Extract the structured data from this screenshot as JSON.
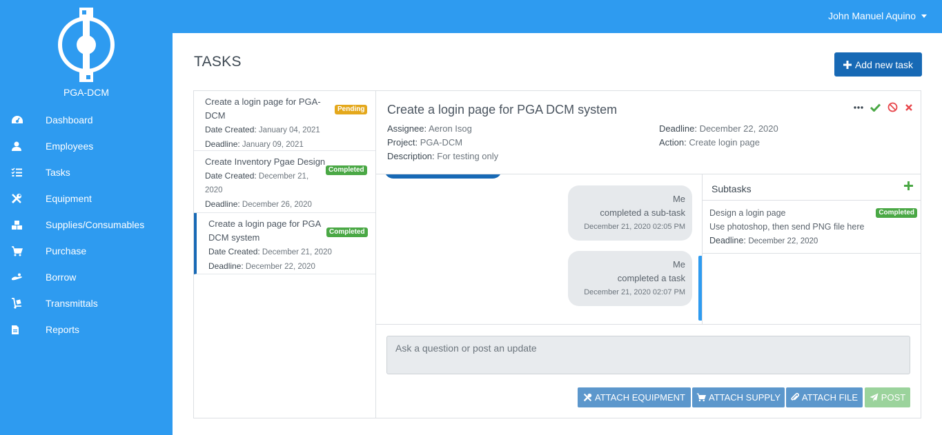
{
  "brand": {
    "name": "PGA-DCM"
  },
  "user": {
    "name": "John Manuel Aquino"
  },
  "nav": [
    {
      "id": "dashboard",
      "label": "Dashboard",
      "icon": "tachometer-icon"
    },
    {
      "id": "employees",
      "label": "Employees",
      "icon": "user-icon"
    },
    {
      "id": "tasks",
      "label": "Tasks",
      "icon": "tasks-list-icon"
    },
    {
      "id": "equipment",
      "label": "Equipment",
      "icon": "tools-icon"
    },
    {
      "id": "supplies",
      "label": "Supplies/Consumables",
      "icon": "boxes-icon"
    },
    {
      "id": "purchase",
      "label": "Purchase",
      "icon": "cart-icon"
    },
    {
      "id": "borrow",
      "label": "Borrow",
      "icon": "hand-icon"
    },
    {
      "id": "transmittals",
      "label": "Transmittals",
      "icon": "dolly-icon"
    },
    {
      "id": "reports",
      "label": "Reports",
      "icon": "file-icon"
    }
  ],
  "page": {
    "title": "TASKS",
    "add_button": "Add new task"
  },
  "tasks": [
    {
      "title": "Create a login page for PGA-DCM",
      "status": "Pending",
      "created_label": "Date Created:",
      "created": "January 04, 2021",
      "deadline_label": "Deadline:",
      "deadline": "January 09, 2021"
    },
    {
      "title": "Create Inventory Pgae Design",
      "status": "Completed",
      "created_label": "Date Created:",
      "created": "December 21, 2020",
      "deadline_label": "Deadline:",
      "deadline": "December 26, 2020"
    },
    {
      "title": "Create a login page for PGA DCM system",
      "status": "Completed",
      "created_label": "Date Created:",
      "created": "December 21, 2020",
      "deadline_label": "Deadline:",
      "deadline": "December 22, 2020"
    }
  ],
  "detail": {
    "title": "Create a login page for PGA DCM system",
    "assignee_label": "Assignee:",
    "assignee": "Aeron Isog",
    "project_label": "Project:",
    "project": "PGA-DCM",
    "description_label": "Description:",
    "description": "For testing only",
    "deadline_label": "Deadline:",
    "deadline": "December 22, 2020",
    "action_label": "Action:",
    "action": "Create login page"
  },
  "messages": [
    {
      "author": "Me",
      "text": "completed a sub-task",
      "time": "December 21, 2020 02:05 PM"
    },
    {
      "author": "Me",
      "text": "completed a task",
      "time": "December 21, 2020 02:07 PM"
    }
  ],
  "subtasks": {
    "title": "Subtasks",
    "items": [
      {
        "title": "Design a login page",
        "status": "Completed",
        "description": "Use photoshop, then send PNG file here",
        "deadline_label": "Deadline:",
        "deadline": "December 22, 2020"
      }
    ]
  },
  "composer": {
    "placeholder": "Ask a question or post an update",
    "attach_equipment": "ATTACH EQUIPMENT",
    "attach_supply": "ATTACH SUPPLY",
    "attach_file": "ATTACH FILE",
    "post": "POST"
  },
  "colors": {
    "primary": "#2e9bf0",
    "dark_blue": "#1769b5",
    "success": "#4aa845",
    "warning": "#e4a81c",
    "danger": "#e8474c"
  }
}
